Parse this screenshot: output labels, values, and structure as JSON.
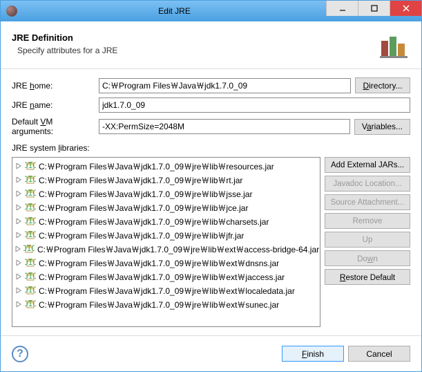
{
  "window": {
    "title": "Edit JRE"
  },
  "banner": {
    "heading": "JRE Definition",
    "subheading": "Specify attributes for a JRE"
  },
  "labels": {
    "jre_home": "JRE home:",
    "jre_name": "JRE name:",
    "vm_args_pre": "Default ",
    "vm_args_u": "V",
    "vm_args_post": "M arguments:",
    "libs": "JRE system libraries:"
  },
  "fields": {
    "jre_home": "C:￦Program Files￦Java￦jdk1.7.0_09",
    "jre_name": "jdk1.7.0_09",
    "vm_args": "-XX:PermSize=2048M"
  },
  "buttons": {
    "directory": "Directory...",
    "variables": "Variables...",
    "add_external": "Add External JARs...",
    "javadoc": "Javadoc Location...",
    "source": "Source Attachment...",
    "remove": "Remove",
    "up": "Up",
    "down": "Down",
    "restore": "Restore Default",
    "finish": "Finish",
    "cancel": "Cancel"
  },
  "buttons_state": {
    "javadoc": false,
    "source": false,
    "remove": false,
    "up": false,
    "down": false
  },
  "libraries": [
    "C:￦Program Files￦Java￦jdk1.7.0_09￦jre￦lib￦resources.jar",
    "C:￦Program Files￦Java￦jdk1.7.0_09￦jre￦lib￦rt.jar",
    "C:￦Program Files￦Java￦jdk1.7.0_09￦jre￦lib￦jsse.jar",
    "C:￦Program Files￦Java￦jdk1.7.0_09￦jre￦lib￦jce.jar",
    "C:￦Program Files￦Java￦jdk1.7.0_09￦jre￦lib￦charsets.jar",
    "C:￦Program Files￦Java￦jdk1.7.0_09￦jre￦lib￦jfr.jar",
    "C:￦Program Files￦Java￦jdk1.7.0_09￦jre￦lib￦ext￦access-bridge-64.jar",
    "C:￦Program Files￦Java￦jdk1.7.0_09￦jre￦lib￦ext￦dnsns.jar",
    "C:￦Program Files￦Java￦jdk1.7.0_09￦jre￦lib￦ext￦jaccess.jar",
    "C:￦Program Files￦Java￦jdk1.7.0_09￦jre￦lib￦ext￦localedata.jar",
    "C:￦Program Files￦Java￦jdk1.7.0_09￦jre￦lib￦ext￦sunec.jar"
  ]
}
